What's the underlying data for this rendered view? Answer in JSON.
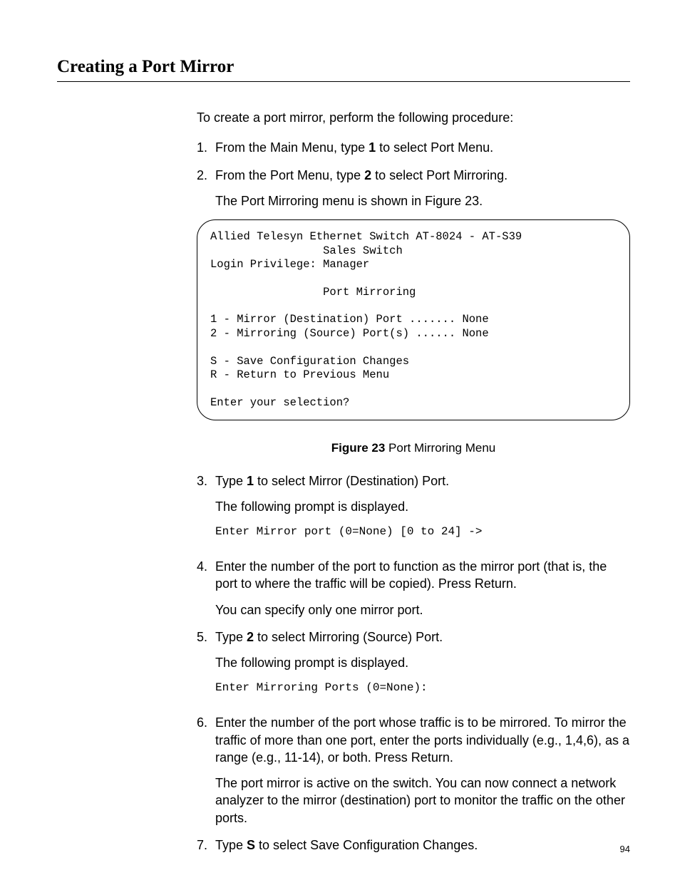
{
  "section_title": "Creating a Port Mirror",
  "intro": "To create a port mirror, perform the following procedure:",
  "steps": [
    {
      "num": "1.",
      "parts": [
        {
          "t": "From the Main Menu, type "
        },
        {
          "t": "1",
          "b": true
        },
        {
          "t": " to select Port Menu."
        }
      ]
    },
    {
      "num": "2.",
      "parts": [
        {
          "t": "From the Port Menu, type "
        },
        {
          "t": "2",
          "b": true
        },
        {
          "t": " to select Port Mirroring."
        }
      ],
      "after": "The Port Mirroring menu is shown in Figure 23."
    }
  ],
  "terminal": "Allied Telesyn Ethernet Switch AT-8024 - AT-S39\n                 Sales Switch\nLogin Privilege: Manager\n\n                 Port Mirroring\n\n1 - Mirror (Destination) Port ....... None\n2 - Mirroring (Source) Port(s) ...... None\n\nS - Save Configuration Changes\nR - Return to Previous Menu\n\nEnter your selection?",
  "figure": {
    "label": "Figure 23",
    "caption": "  Port Mirroring Menu"
  },
  "steps2": [
    {
      "num": "3.",
      "parts": [
        {
          "t": "Type "
        },
        {
          "t": "1",
          "b": true
        },
        {
          "t": " to select Mirror (Destination) Port."
        }
      ],
      "after": "The following prompt is displayed.",
      "mono": "Enter Mirror port (0=None) [0 to 24] ->"
    },
    {
      "num": "4.",
      "plain": "Enter the number of the port to function as the mirror port (that is, the port to where the traffic will be copied). Press Return.",
      "after": "You can specify only one mirror port."
    },
    {
      "num": "5.",
      "parts": [
        {
          "t": "Type "
        },
        {
          "t": "2",
          "b": true
        },
        {
          "t": " to select Mirroring (Source) Port."
        }
      ],
      "after": "The following prompt is displayed.",
      "mono": "Enter Mirroring Ports (0=None):"
    },
    {
      "num": "6.",
      "plain": "Enter the number of the port whose traffic is to be mirrored. To mirror the traffic of more than one port, enter the ports individually (e.g., 1,4,6), as a range (e.g., 11-14), or both. Press Return.",
      "after": "The port mirror is active on the switch. You can now connect a network analyzer to the mirror (destination) port to monitor the traffic on the other ports."
    },
    {
      "num": "7.",
      "parts": [
        {
          "t": "Type "
        },
        {
          "t": "S",
          "b": true
        },
        {
          "t": " to select Save Configuration Changes."
        }
      ]
    }
  ],
  "page_number": "94"
}
